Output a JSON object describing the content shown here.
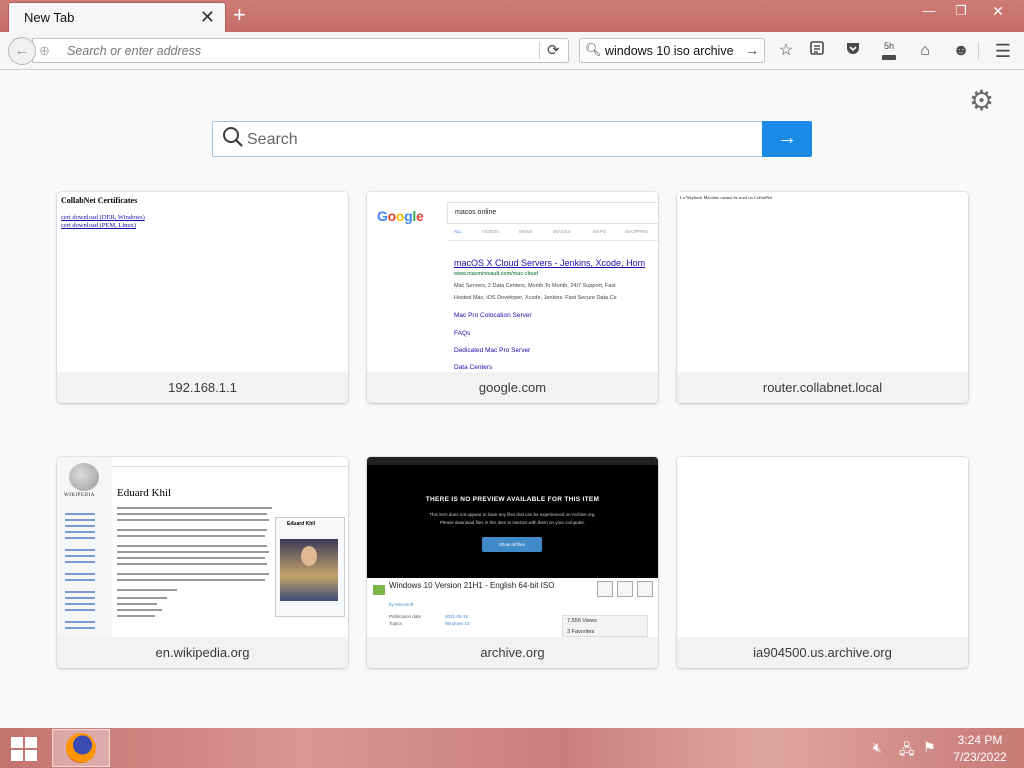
{
  "window": {
    "tab_title": "New Tab",
    "tab_close": "✕",
    "new_tab": "+",
    "minimize": "—",
    "maximize": "❐",
    "close": "✕"
  },
  "toolbar": {
    "back": "←",
    "url_placeholder": "Search or enter address",
    "reload": "⟳",
    "search_value": "windows 10 iso archive",
    "search_go": "→",
    "download_time": "5h",
    "icons": [
      "star-icon",
      "reader-list-icon",
      "pocket-icon",
      "downloads-icon",
      "home-icon",
      "hello-icon",
      "hamburger-menu-icon"
    ]
  },
  "newtab": {
    "settings": "⚙",
    "search_placeholder": "Search",
    "search_go": "→",
    "tiles": [
      {
        "label": "192.168.1.1"
      },
      {
        "label": "google.com"
      },
      {
        "label": "router.collabnet.local"
      },
      {
        "label": "en.wikipedia.org"
      },
      {
        "label": "archive.org"
      },
      {
        "label": "ia904500.us.archive.org"
      }
    ],
    "thumb_collabnet": {
      "title": "CollabNet Certificates",
      "link1": "cert download (DER, Windows)",
      "link2": "cert download (PEM, Linux)"
    },
    "thumb_google": {
      "logo": "Google",
      "query": "macos online",
      "tabs": [
        "ALL",
        "VIDEOS",
        "NEWS",
        "IMAGES",
        "MAPS",
        "SHOPPING"
      ],
      "result_title": "macOS X Cloud Servers - Jenkins, Xcode, Hom",
      "result_url": "www.macminivault.com/mac-cloud",
      "snippet1": "Mac Servers, 2 Data Centers, Month To Month, 24/7 Support, Fast",
      "snippet2": "Hosted Mac, iOS Developer, Xcode, Jenkins. Fast Secure Data Ce",
      "link1": "Mac Pro Colocation Server",
      "link2": "FAQs",
      "link3": "Dedicated Mac Pro Server",
      "link4": "Data Centers"
    },
    "thumb_router": {
      "text": "La Wayback Machine cannot be used on CollabNet"
    },
    "thumb_wikipedia": {
      "wordmark": "WIKIPEDIA",
      "heading": "Eduard Khil",
      "infobox_title": "Eduard Khil"
    },
    "thumb_archive": {
      "notice": "THERE IS NO PREVIEW AVAILABLE FOR THIS ITEM",
      "sub1": "This item does not appear to have any files that can be experienced on Archive.org.",
      "sub2": "Please download files in this item to interact with them on your computer.",
      "button": "Show all files",
      "item_title": "Windows 10 Version 21H1 - English 64-bit ISO",
      "item_by": "by Microsoft",
      "views": "7,556 Views",
      "favorites": "3 Favorites",
      "meta_label1": "Publication date",
      "meta_val1": "2021-05-18",
      "meta_label2": "Topics",
      "meta_val2": "Windows 10"
    }
  },
  "taskbar": {
    "clock_time": "3:24 PM",
    "clock_date": "7/23/2022",
    "tray_icons": [
      "volume-muted-icon",
      "network-icon",
      "action-center-icon"
    ]
  }
}
